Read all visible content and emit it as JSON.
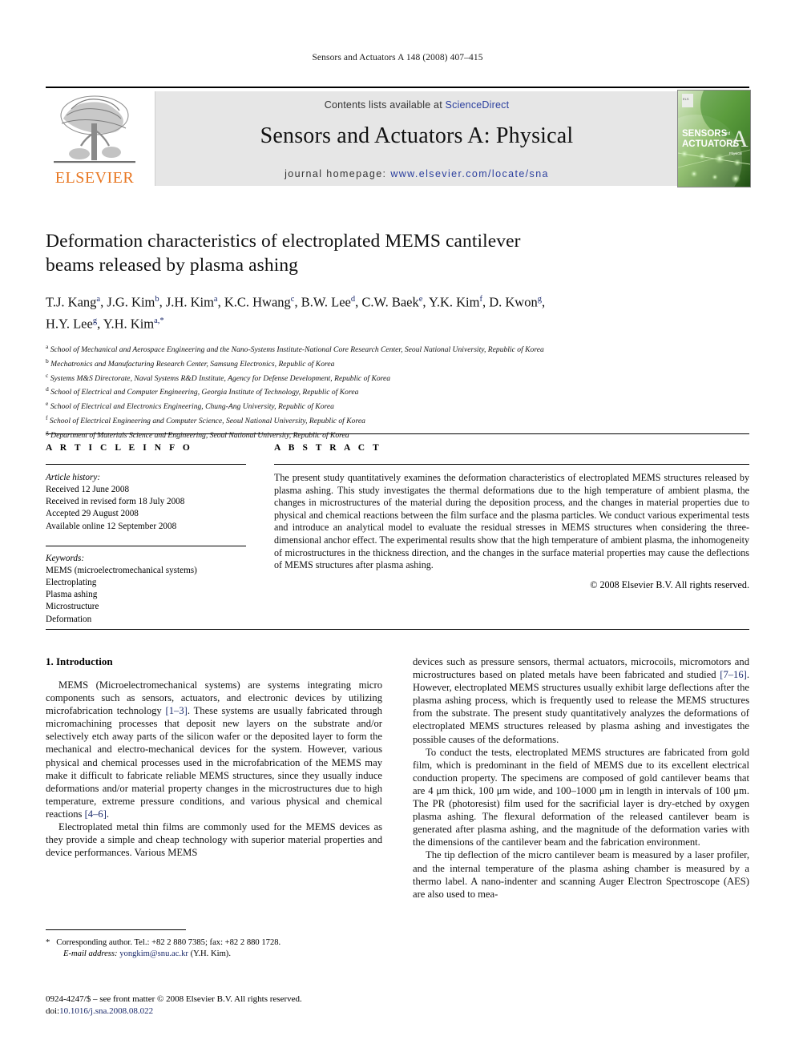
{
  "running_head": "Sensors and Actuators A 148 (2008) 407–415",
  "header": {
    "publisher": "ELSEVIER",
    "contents_prefix": "Contents lists available at ",
    "contents_link": "ScienceDirect",
    "journal_title": "Sensors and Actuators A: Physical",
    "homepage_prefix": "journal homepage:",
    "homepage_url": "www.elsevier.com/locate/sna",
    "cover": {
      "line1": "SENSORS",
      "and": "and",
      "line2": "ACTUATORS",
      "letter": "A",
      "sub": "Physical"
    },
    "link_color": "#2b3f9e",
    "band_color": "#e6e6e6",
    "elsevier_orange": "#E87722"
  },
  "article": {
    "title_line1": "Deformation characteristics of electroplated MEMS cantilever",
    "title_line2": "beams released by plasma ashing",
    "authors_line1_html": "T.J. Kang<sup>a</sup>, J.G. Kim<sup>b</sup>, J.H. Kim<sup>a</sup>, K.C. Hwang<sup>c</sup>, B.W. Lee<sup>d</sup>, C.W. Baek<sup>e</sup>, Y.K. Kim<sup>f</sup>, D. Kwon<sup>g</sup>,",
    "authors_line2_html": "H.Y. Lee<sup>g</sup>, Y.H. Kim<sup>a,<span class=\"star\">*</span></sup>",
    "affiliations": [
      {
        "marker": "a",
        "text": "School of Mechanical and Aerospace Engineering and the Nano-Systems Institute-National Core Research Center, Seoul National University, Republic of Korea"
      },
      {
        "marker": "b",
        "text": "Mechatronics and Manufacturing Research Center, Samsung Electronics, Republic of Korea"
      },
      {
        "marker": "c",
        "text": "Systems M&S Directorate, Naval Systems R&D Institute, Agency for Defense Development, Republic of Korea"
      },
      {
        "marker": "d",
        "text": "School of Electrical and Computer Engineering, Georgia Institute of Technology, Republic of Korea"
      },
      {
        "marker": "e",
        "text": "School of Electrical and Electronics Engineering, Chung-Ang University, Republic of Korea"
      },
      {
        "marker": "f",
        "text": "School of Electrical Engineering and Computer Science, Seoul National University, Republic of Korea"
      },
      {
        "marker": "g",
        "text": "Department of Materials Science and Engineering, Seoul National University, Republic of Korea"
      }
    ]
  },
  "article_info": {
    "heading": "A R T I C L E    I N F O",
    "history_label": "Article history:",
    "history": [
      "Received 12 June 2008",
      "Received in revised form 18 July 2008",
      "Accepted 29 August 2008",
      "Available online 12 September 2008"
    ],
    "keywords_label": "Keywords:",
    "keywords": [
      "MEMS (microelectromechanical systems)",
      "Electroplating",
      "Plasma ashing",
      "Microstructure",
      "Deformation"
    ]
  },
  "abstract": {
    "heading": "A B S T R A C T",
    "text": "The present study quantitatively examines the deformation characteristics of electroplated MEMS structures released by plasma ashing. This study investigates the thermal deformations due to the high temperature of ambient plasma, the changes in microstructures of the material during the deposition process, and the changes in material properties due to physical and chemical reactions between the film surface and the plasma particles. We conduct various experimental tests and introduce an analytical model to evaluate the residual stresses in MEMS structures when considering the three-dimensional anchor effect. The experimental results show that the high temperature of ambient plasma, the inhomogeneity of microstructures in the thickness direction, and the changes in the surface material properties may cause the deflections of MEMS structures after plasma ashing.",
    "copyright": "© 2008 Elsevier B.V. All rights reserved."
  },
  "body": {
    "section_title": "1.  Introduction",
    "left_paragraphs": [
      "MEMS (Microelectromechanical systems) are systems integrating micro components such as sensors, actuators, and electronic devices by utilizing microfabrication technology [1–3]. These systems are usually fabricated through micromachining processes that deposit new layers on the substrate and/or selectively etch away parts of the silicon wafer or the deposited layer to form the mechanical and electro-mechanical devices for the system. However, various physical and chemical processes used in the microfabrication of the MEMS may make it difficult to fabricate reliable MEMS structures, since they usually induce deformations and/or material property changes in the microstructures due to high temperature, extreme pressure conditions, and various physical and chemical reactions [4–6].",
      "Electroplated metal thin films are commonly used for the MEMS devices as they provide a simple and cheap technology with superior material properties and device performances. Various MEMS"
    ],
    "right_paragraphs": [
      "devices such as pressure sensors, thermal actuators, microcoils, micromotors and microstructures based on plated metals have been fabricated and studied [7–16]. However, electroplated MEMS structures usually exhibit large deflections after the plasma ashing process, which is frequently used to release the MEMS structures from the substrate. The present study quantitatively analyzes the deformations of electroplated MEMS structures released by plasma ashing and investigates the possible causes of the deformations.",
      "To conduct the tests, electroplated MEMS structures are fabricated from gold film, which is predominant in the field of MEMS due to its excellent electrical conduction property. The specimens are composed of gold cantilever beams that are 4 μm thick, 100 μm wide, and 100–1000 μm in length in intervals of 100 μm. The PR (photoresist) film used for the sacrificial layer is dry-etched by oxygen plasma ashing. The flexural deformation of the released cantilever beam is generated after plasma ashing, and the magnitude of the deformation varies with the dimensions of the cantilever beam and the fabrication environment.",
      "The tip deflection of the micro cantilever beam is measured by a laser profiler, and the internal temperature of the plasma ashing chamber is measured by a thermo label. A nano-indenter and scanning Auger Electron Spectroscope (AES) are also used to mea-"
    ]
  },
  "footnote": {
    "marker": "*",
    "corresponding": "Corresponding author. Tel.: +82 2 880 7385; fax: +82 2 880 1728.",
    "email_label": "E-mail address:",
    "email": "yongkim@snu.ac.kr",
    "email_suffix": "(Y.H. Kim)."
  },
  "colophon": {
    "line1": "0924-4247/$ – see front matter © 2008 Elsevier B.V. All rights reserved.",
    "doi_label": "doi:",
    "doi": "10.1016/j.sna.2008.08.022"
  }
}
